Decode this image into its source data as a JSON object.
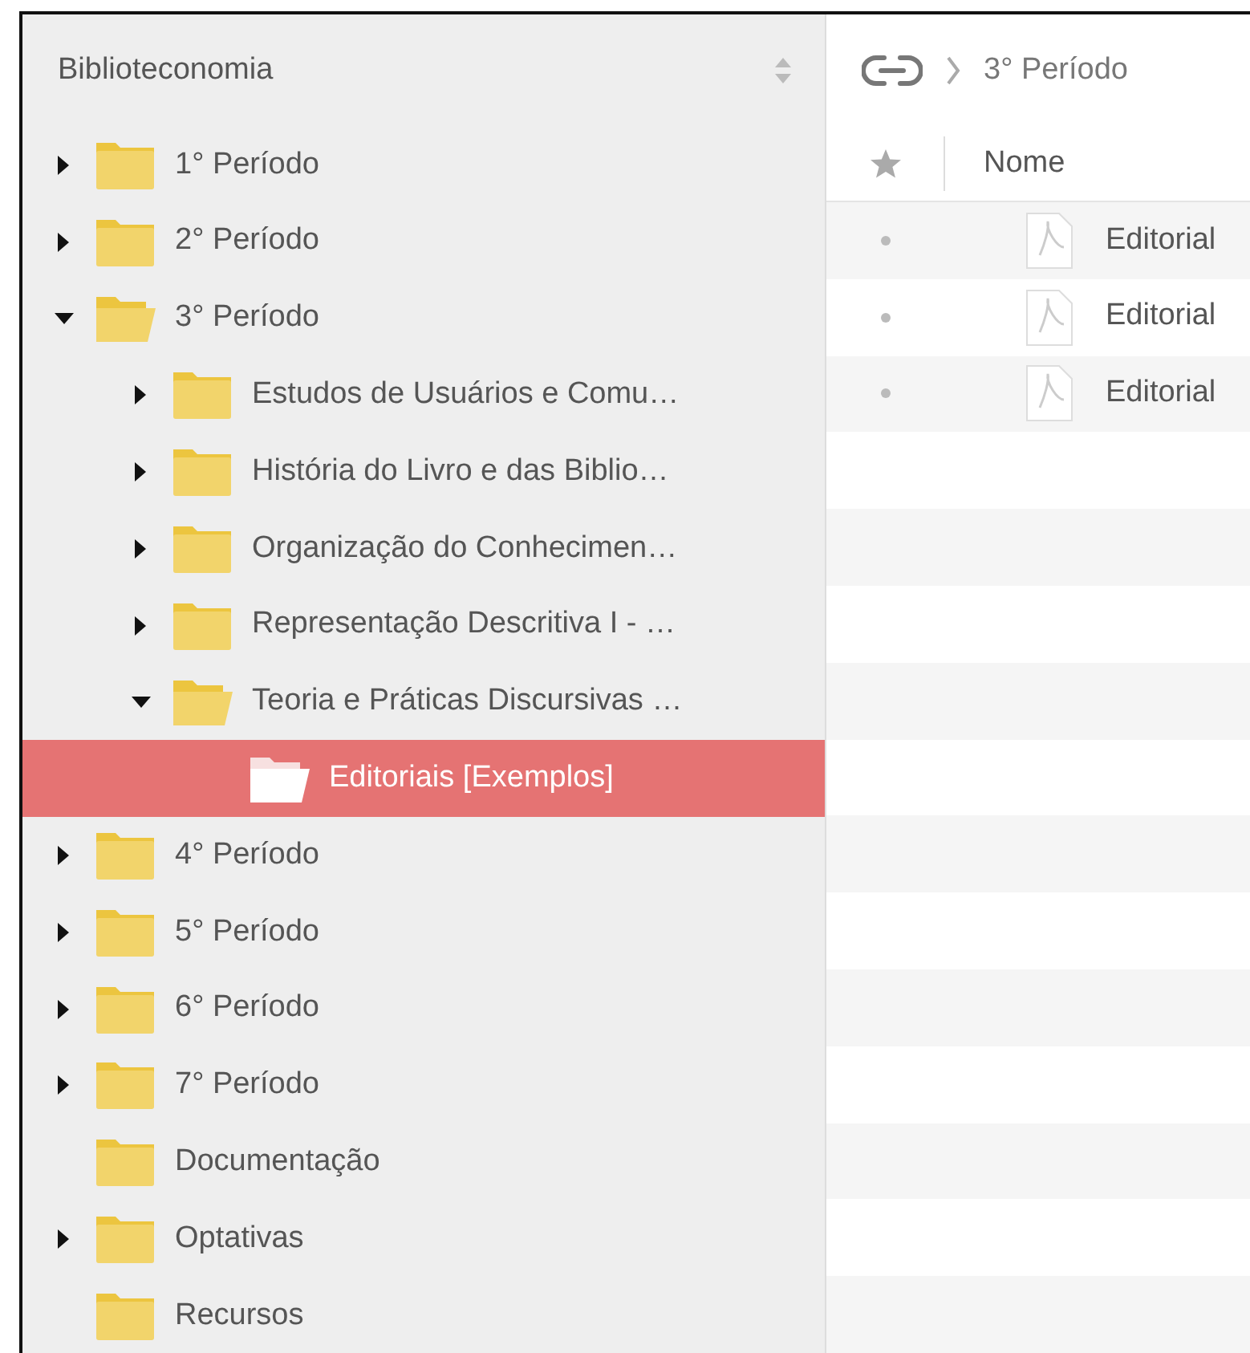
{
  "sidebar": {
    "title": "Biblioteconomia",
    "tree": [
      {
        "label": "1° Período",
        "expanded": false,
        "selected": false
      },
      {
        "label": "2° Período",
        "expanded": false,
        "selected": false
      },
      {
        "label": "3° Período",
        "expanded": true,
        "selected": false,
        "children": [
          {
            "label": "Estudos de Usuários e Comu…",
            "expanded": false,
            "selected": false
          },
          {
            "label": "História do Livro e das Biblio…",
            "expanded": false,
            "selected": false
          },
          {
            "label": "Organização do Conhecimen…",
            "expanded": false,
            "selected": false
          },
          {
            "label": "Representação Descritiva I - …",
            "expanded": false,
            "selected": false
          },
          {
            "label": "Teoria e Práticas Discursivas …",
            "expanded": true,
            "selected": false,
            "children": [
              {
                "label": "Editoriais [Exemplos]",
                "selected": true
              }
            ]
          }
        ]
      },
      {
        "label": "4° Período",
        "expanded": false,
        "selected": false
      },
      {
        "label": "5° Período",
        "expanded": false,
        "selected": false
      },
      {
        "label": "6° Período",
        "expanded": false,
        "selected": false
      },
      {
        "label": "7° Período",
        "expanded": false,
        "selected": false
      },
      {
        "label": "Documentação",
        "selected": false
      },
      {
        "label": "Optativas",
        "expanded": false,
        "selected": false
      },
      {
        "label": "Recursos",
        "selected": false
      }
    ]
  },
  "breadcrumb": {
    "current": "3° Período"
  },
  "table": {
    "columns": [
      "Nome"
    ],
    "rows": [
      {
        "name": "Editorial"
      },
      {
        "name": "Editorial"
      },
      {
        "name": "Editorial"
      }
    ]
  }
}
